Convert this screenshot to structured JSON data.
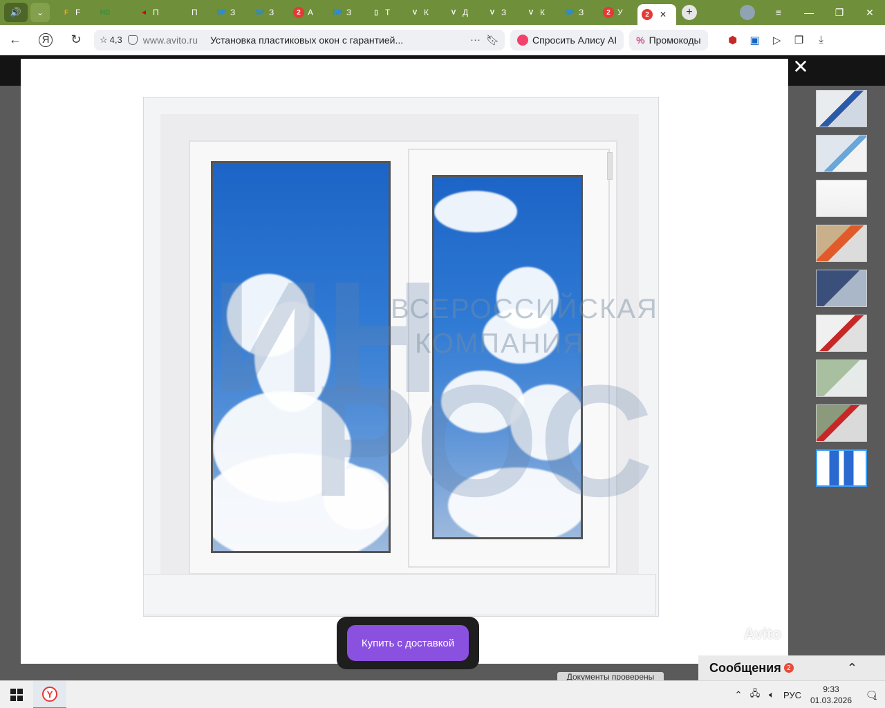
{
  "browser": {
    "tabs": [
      {
        "icon_text": "F",
        "icon_color": "#f5a623",
        "label": "F",
        "active": false
      },
      {
        "icon_text": "HD",
        "icon_color": "#3b8f3b",
        "label": "",
        "active": false
      },
      {
        "icon_text": "◄",
        "icon_color": "#d0021b",
        "label": "П",
        "active": false
      },
      {
        "icon_text": "",
        "icon_color": "#2e7d32",
        "label": "П",
        "active": false
      },
      {
        "icon_text": "SP",
        "icon_color": "#1e88e5",
        "label": "З",
        "active": false
      },
      {
        "icon_text": "SP",
        "icon_color": "#1e88e5",
        "label": "З",
        "active": false
      },
      {
        "icon_text": "2",
        "icon_color": "#e53935",
        "label": "А",
        "active": false
      },
      {
        "icon_text": "SP",
        "icon_color": "#1e88e5",
        "label": "З",
        "active": false
      },
      {
        "icon_text": "▯",
        "icon_color": "#ffffff",
        "label": "Т",
        "active": false
      },
      {
        "icon_text": "V",
        "icon_color": "#ffffff",
        "label": "К",
        "active": false
      },
      {
        "icon_text": "V",
        "icon_color": "#ffffff",
        "label": "Д",
        "active": false
      },
      {
        "icon_text": "V",
        "icon_color": "#ffffff",
        "label": "З",
        "active": false
      },
      {
        "icon_text": "V",
        "icon_color": "#ffffff",
        "label": "К",
        "active": false
      },
      {
        "icon_text": "SP",
        "icon_color": "#1e88e5",
        "label": "З",
        "active": false
      },
      {
        "icon_text": "2",
        "icon_color": "#e53935",
        "label": "У",
        "active": false
      },
      {
        "icon_text": "2",
        "icon_color": "#e53935",
        "label": "",
        "active": true
      }
    ],
    "new_tab": "+",
    "win_controls": {
      "menu": "≡",
      "minimize": "—",
      "restore": "❐",
      "close": "✕"
    },
    "nav": {
      "back": "←",
      "yandex": "Я",
      "reload": "↻"
    },
    "rating": "4,3",
    "domain": "www.avito.ru",
    "page_title": "Установка пластиковых окон с гарантией...",
    "more": "···",
    "alice_label": "Спросить Алису AI",
    "promo_label": "Промокоды",
    "promo_icon": "%"
  },
  "viewer": {
    "close": "✕",
    "watermark_line1": "ВСЕРОССИЙСКАЯ",
    "watermark_line2": "КОМПАНИЯ",
    "avito_watermark": "Avito",
    "buy_button": "Купить с доставкой",
    "thumbnail_count": 9,
    "selected_thumbnail": 9
  },
  "page": {
    "documents_verified": "Документы проверены",
    "messages_label": "Сообщения",
    "messages_badge": "2",
    "messages_chevron": "⌃"
  },
  "taskbar": {
    "lang": "РУС",
    "time": "9:33",
    "date": "01.03.2026",
    "notifications": "1"
  }
}
